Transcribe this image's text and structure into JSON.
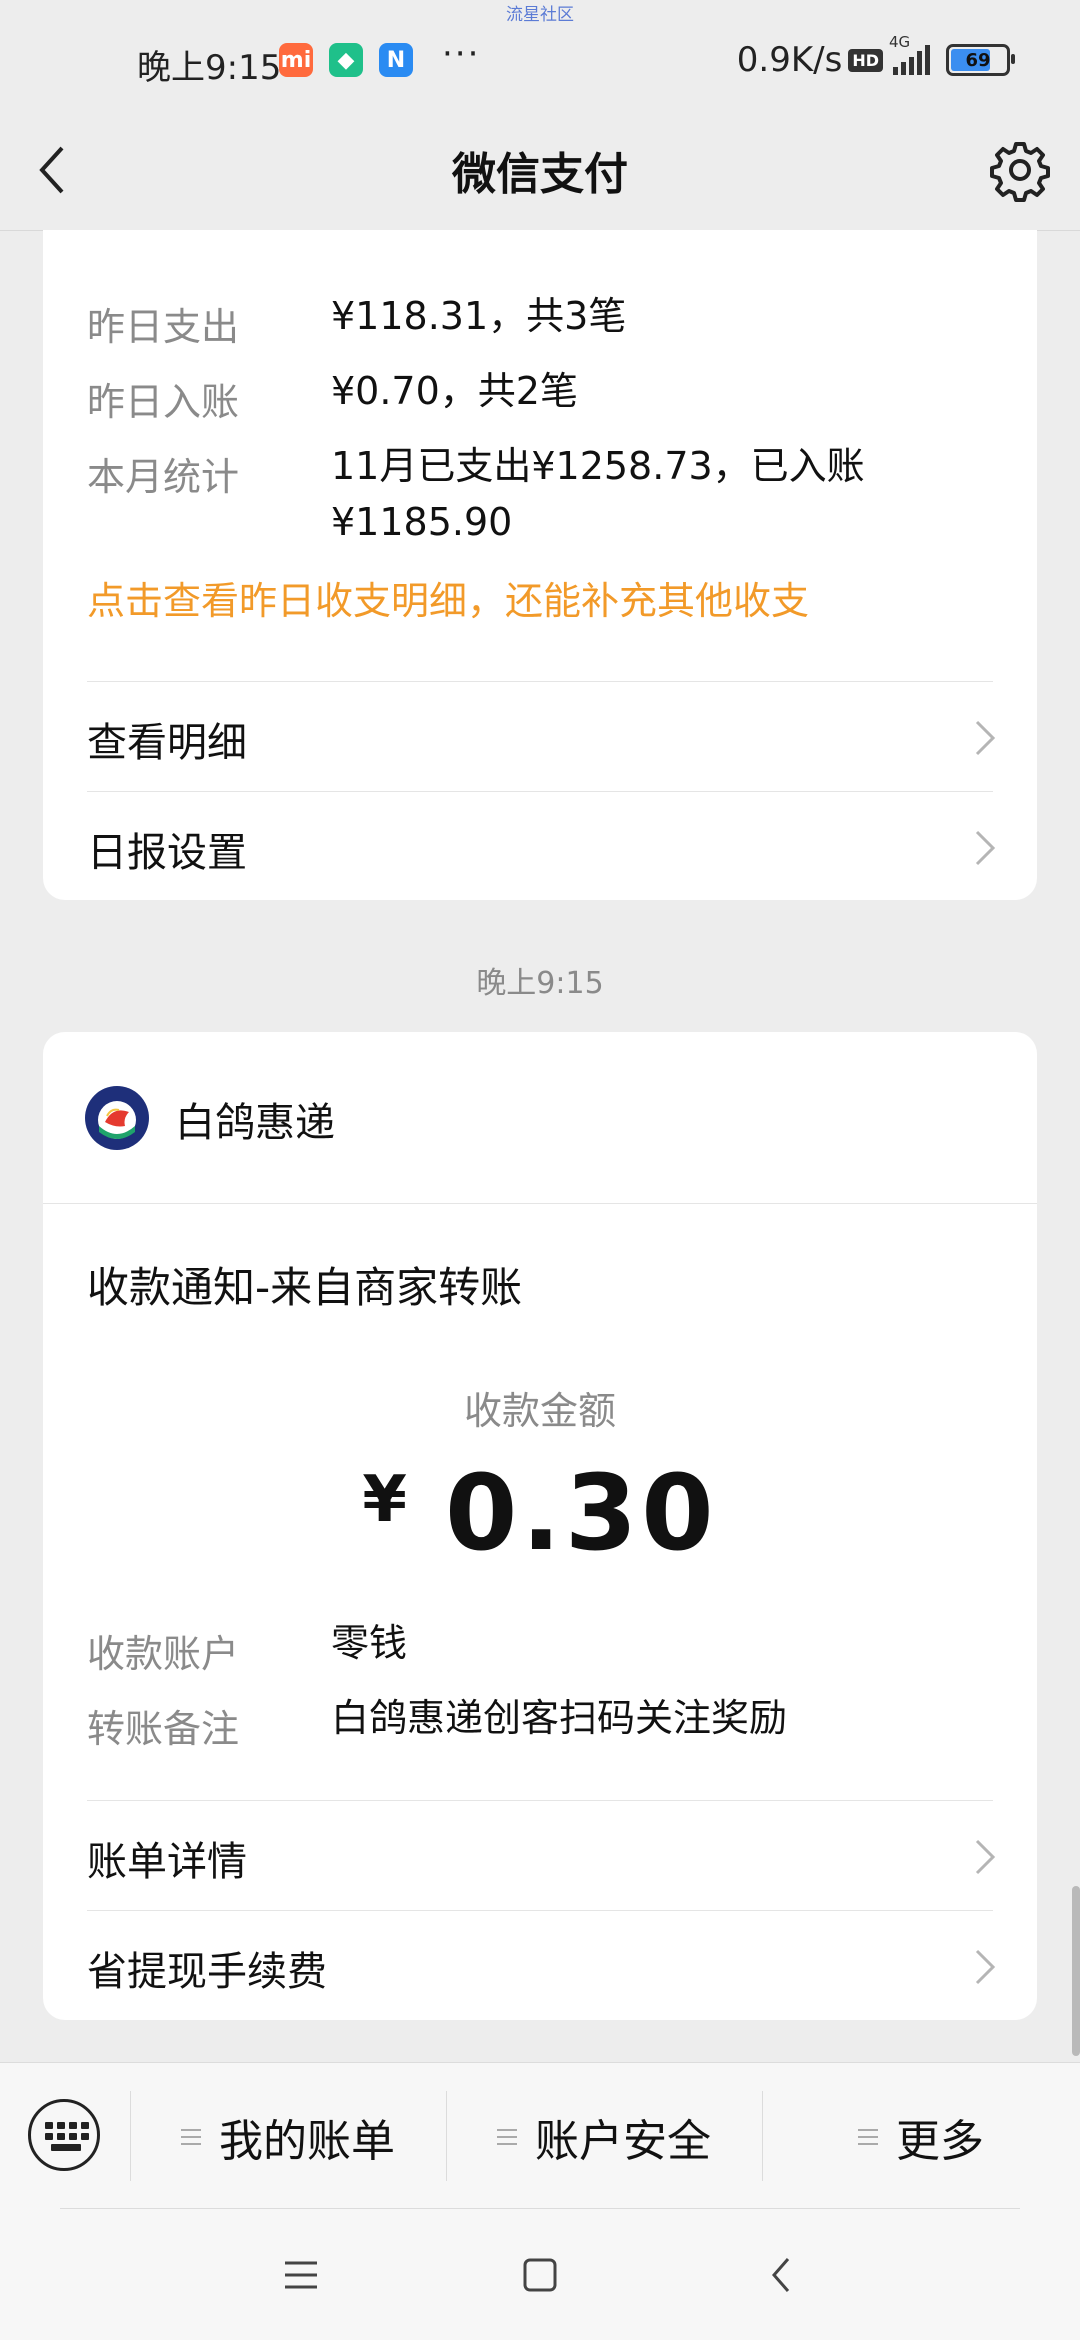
{
  "watermark": "流星社区",
  "status": {
    "time": "晚上9:15",
    "app_badges": [
      {
        "label": "mi",
        "color": "#ff6a3d"
      },
      {
        "label": "◆",
        "color": "#1fc08a"
      },
      {
        "label": "N",
        "color": "#2a8bf2"
      }
    ],
    "more": "···",
    "speed": "0.9K/s",
    "hd": "HD",
    "network": "4G",
    "battery": "69"
  },
  "nav": {
    "title": "微信支付"
  },
  "daily_report": {
    "rows": [
      {
        "label": "昨日支出",
        "value": "¥118.31，共3笔"
      },
      {
        "label": "昨日入账",
        "value": "¥0.70，共2笔"
      },
      {
        "label": "本月统计",
        "value_line1": "11月已支出¥1258.73，已入账",
        "value_line2": "¥1185.90"
      }
    ],
    "hint": "点击查看昨日收支明细，还能补充其他收支",
    "links": [
      "查看明细",
      "日报设置"
    ]
  },
  "timestamp": "晚上9:15",
  "notice": {
    "merchant": "白鸽惠递",
    "title": "收款通知-来自商家转账",
    "amount_label": "收款金额",
    "currency": "¥",
    "amount": "0.30",
    "rows": [
      {
        "label": "收款账户",
        "value": "零钱"
      },
      {
        "label": "转账备注",
        "value": "白鸽惠递创客扫码关注奖励"
      }
    ],
    "links": [
      "账单详情",
      "省提现手续费"
    ]
  },
  "menu": {
    "items": [
      "我的账单",
      "账户安全",
      "更多"
    ]
  },
  "colors": {
    "accent_orange": "#f29a29",
    "muted": "#8a8a8a",
    "background": "#ededed"
  }
}
